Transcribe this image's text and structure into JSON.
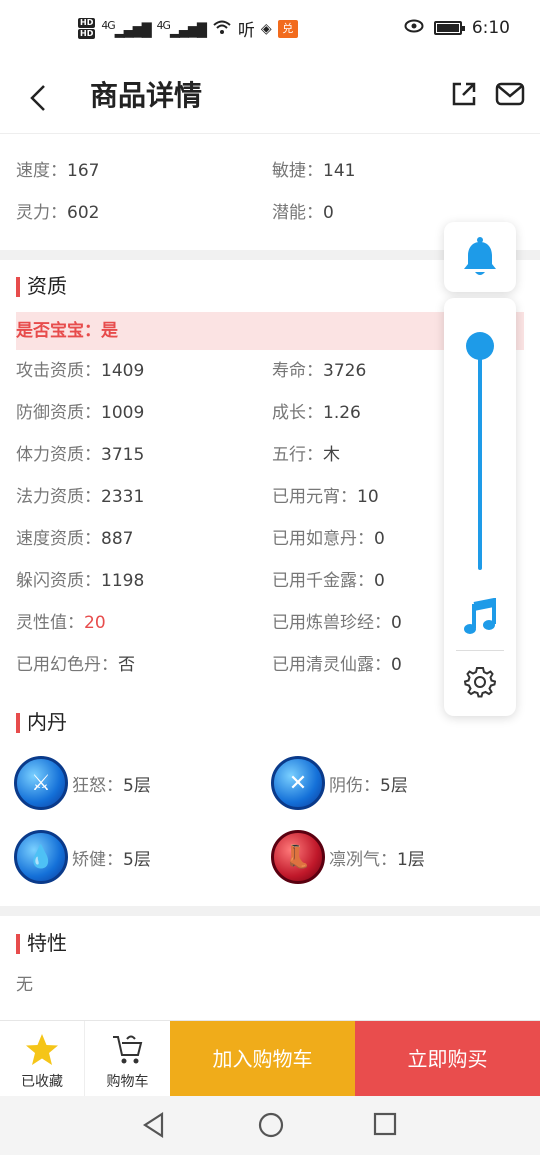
{
  "status_bar": {
    "hd1": "HD",
    "hd2": "HD",
    "net1": "4G",
    "net2": "4G",
    "time": "6:10",
    "app_badge": "兑"
  },
  "header": {
    "title": "商品详情",
    "back_icon": "chevron-left-icon",
    "share_icon": "share-icon",
    "mail_icon": "mail-icon"
  },
  "top_stats": [
    {
      "l1": "速度：",
      "v1": "167",
      "l2": "敏捷：",
      "v2": "141"
    },
    {
      "l1": "灵力：",
      "v1": "602",
      "l2": "潜能：",
      "v2": "0"
    }
  ],
  "aptitude": {
    "title": "资质",
    "pet_label": "是否宝宝：是",
    "rows": [
      {
        "l1": "攻击资质：",
        "v1": "1409",
        "l2": "寿命：",
        "v2": "3726"
      },
      {
        "l1": "防御资质：",
        "v1": "1009",
        "l2": "成长：",
        "v2": "1.26"
      },
      {
        "l1": "体力资质：",
        "v1": "3715",
        "l2": "五行：",
        "v2": "木"
      },
      {
        "l1": "法力资质：",
        "v1": "2331",
        "l2": "已用元宵：",
        "v2": "10"
      },
      {
        "l1": "速度资质：",
        "v1": "887",
        "l2": "已用如意丹：",
        "v2": "0"
      },
      {
        "l1": "躲闪资质：",
        "v1": "1198",
        "l2": "已用千金露：",
        "v2": "0"
      },
      {
        "l1": "灵性值：",
        "v1": "20",
        "l2": "已用炼兽珍经：",
        "v2": "0"
      },
      {
        "l1": "已用幻色丹：",
        "v1": "否",
        "l2": "已用清灵仙露：",
        "v2": "0"
      }
    ]
  },
  "neidan": {
    "title": "内丹",
    "items": [
      {
        "name": "狂怒：",
        "level": "5层"
      },
      {
        "name": "阴伤：",
        "level": "5层"
      },
      {
        "name": "矫健：",
        "level": "5层"
      },
      {
        "name": "凛冽气：",
        "level": "1层"
      }
    ]
  },
  "traits": {
    "title": "特性",
    "value": "无"
  },
  "bottom": {
    "fav_label": "已收藏",
    "cart_label": "购物车",
    "add_cart": "加入购物车",
    "buy_now": "立即购买"
  },
  "float_panel": {
    "volume_level": 0.95
  },
  "colors": {
    "accent_red": "#e74c4c",
    "accent_yellow": "#f0ac1a",
    "accent_blue": "#1e9be8"
  }
}
